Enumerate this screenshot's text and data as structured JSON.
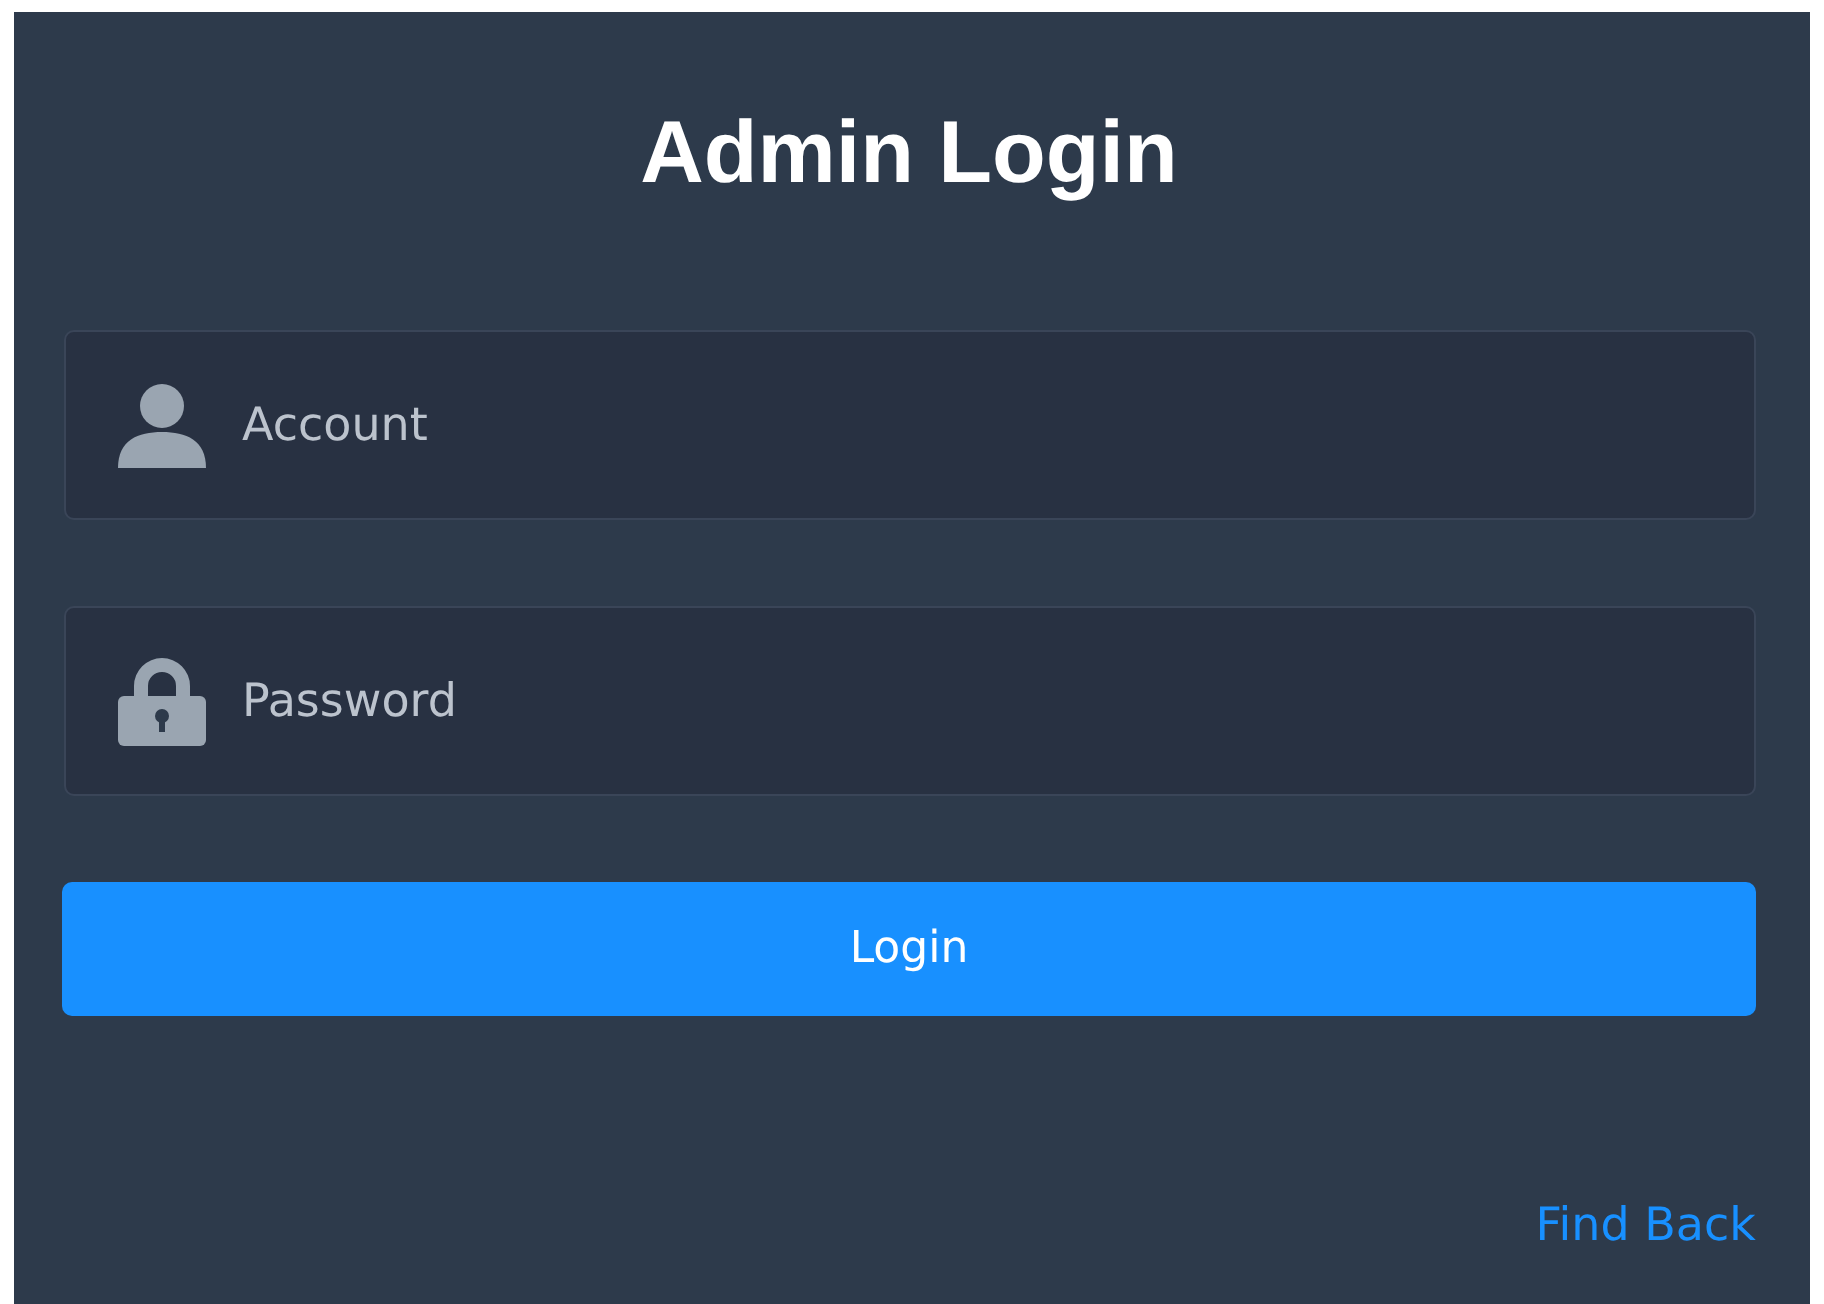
{
  "title": "Admin Login",
  "fields": [
    {
      "kind": "account",
      "placeholder": "Account"
    },
    {
      "kind": "password",
      "placeholder": "Password"
    }
  ],
  "login_button": "Login",
  "find_back_link": "Find Back"
}
